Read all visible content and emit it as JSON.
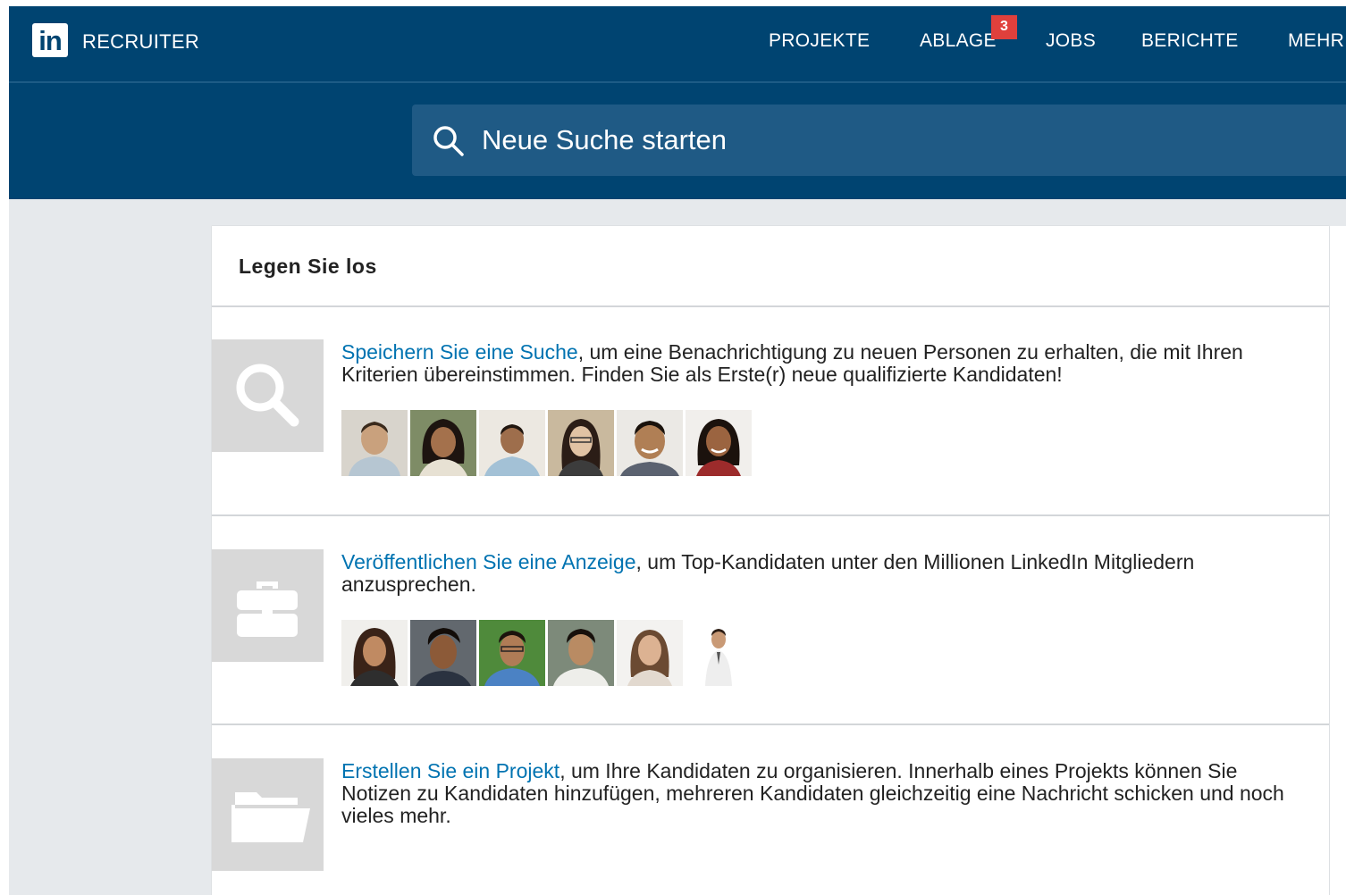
{
  "header": {
    "logo_text": "in",
    "brand": "RECRUITER",
    "nav": [
      {
        "label": "PROJEKTE"
      },
      {
        "label": "ABLAGE"
      },
      {
        "label": "JOBS"
      },
      {
        "label": "BERICHTE"
      },
      {
        "label": "MEHR"
      }
    ],
    "badge_count": "3"
  },
  "search": {
    "placeholder": "Neue Suche starten"
  },
  "card": {
    "title": "Legen Sie los",
    "items": [
      {
        "icon": "search-icon",
        "link": "Speichern Sie eine Suche",
        "text": ", um eine Benachrichtigung zu neuen Personen zu erhalten, die mit Ihren Kriterien übereinstimmen. Finden Sie als Erste(r) neue qualifizierte Kandidaten!"
      },
      {
        "icon": "briefcase-icon",
        "link": "Veröffentlichen Sie eine Anzeige",
        "text": ", um Top-Kandidaten unter den Millionen LinkedIn Mitgliedern anzusprechen."
      },
      {
        "icon": "folder-icon",
        "link": "Erstellen Sie ein Projekt",
        "text": ", um Ihre Kandidaten zu organisieren. Innerhalb eines Projekts können Sie Notizen zu Kandidaten hinzufügen, mehreren Kandidaten gleichzeitig eine Nachricht schicken und noch vieles mehr."
      }
    ]
  },
  "colors": {
    "header_bg": "#004471",
    "search_bg": "#1f5a85",
    "link": "#0073b1",
    "badge": "#e0403c",
    "page_bg": "#e6e9ec"
  }
}
